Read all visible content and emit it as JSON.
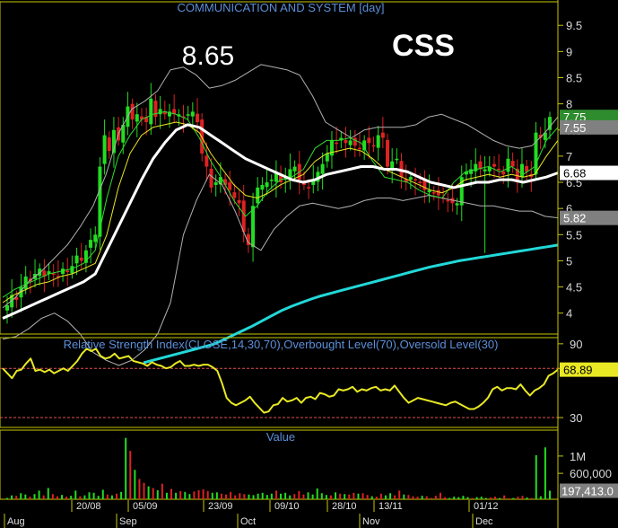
{
  "chart_data": [
    {
      "type": "candlestick",
      "title": "COMMUNICATION AND SYSTEM [day]",
      "symbol": "CSS",
      "peak_annotation": "8.65",
      "ylim": [
        3.6,
        9.95
      ],
      "yticks": [
        "9.5",
        "9",
        "8.5",
        "8",
        "7.5",
        "7",
        "6.5",
        "6",
        "5.5",
        "5",
        "4.5",
        "4"
      ],
      "price_badges": [
        {
          "label": "7.75",
          "value": 7.75,
          "bg": "#2e8b2e",
          "fg": "#ffffff"
        },
        {
          "label": "7.55",
          "value": 7.55,
          "bg": "#808080",
          "fg": "#ffffff"
        },
        {
          "label": "6.68",
          "value": 6.68,
          "bg": "#ffffff",
          "fg": "#000000"
        },
        {
          "label": "5.82",
          "value": 5.82,
          "bg": "#808080",
          "fg": "#ffffff"
        }
      ],
      "x_dates": [
        "20/08",
        "05/09",
        "23/09",
        "09/10",
        "28/10",
        "13/11",
        "01/12"
      ],
      "x_months": [
        "Aug",
        "Sep",
        "Oct",
        "Nov",
        "Dec"
      ],
      "series": [
        {
          "name": "close",
          "color": "#ffffff",
          "values": [
            4.15,
            4.35,
            4.25,
            4.5,
            4.7,
            4.6,
            4.75,
            4.85,
            4.7,
            4.8,
            4.75,
            4.7,
            4.85,
            4.8,
            4.9,
            5.1,
            5.0,
            5.2,
            5.4,
            5.5,
            6.8,
            7.4,
            7.1,
            7.5,
            7.3,
            7.6,
            7.95,
            7.7,
            7.8,
            7.7,
            7.65,
            8.1,
            7.75,
            7.9,
            7.8,
            7.85,
            7.8,
            7.8,
            7.75,
            7.8,
            7.85,
            7.65,
            7.05,
            6.8,
            6.4,
            6.5,
            6.6,
            6.45,
            6.35,
            6.2,
            6.1,
            5.55,
            5.3,
            6.05,
            6.4,
            6.45,
            6.5,
            6.55,
            6.7,
            6.5,
            6.6,
            6.75,
            6.8,
            6.55,
            6.45,
            6.4,
            6.55,
            6.7,
            6.85,
            7.05,
            7.3,
            7.25,
            7.35,
            7.25,
            7.3,
            7.2,
            7.15,
            7.3,
            7.25,
            7.2,
            7.4,
            7.35,
            6.8,
            6.9,
            6.95,
            6.6,
            6.5,
            6.6,
            6.55,
            6.5,
            6.35,
            6.35,
            6.3,
            6.25,
            6.2,
            6.15,
            6.1,
            6.1,
            6.6,
            6.7,
            6.75,
            6.85,
            6.75,
            6.75,
            6.8,
            6.8,
            6.75,
            6.65,
            6.95,
            6.8,
            6.55,
            6.85,
            6.7,
            6.6,
            7.45,
            7.35,
            7.45,
            7.75
          ]
        },
        {
          "name": "bb_upper",
          "color": "#b0b0b0",
          "values": [
            4.1,
            4.3,
            4.6,
            4.8,
            5.05,
            5.3,
            5.65,
            6.05,
            6.65,
            7.45,
            7.9,
            8.05,
            8.25,
            8.65,
            8.7,
            8.55,
            8.3,
            8.35,
            8.45,
            8.6,
            8.75,
            8.7,
            8.65,
            8.55,
            8.15,
            7.65,
            7.5,
            7.35,
            7.5,
            7.55,
            7.55,
            7.55,
            7.6,
            7.75,
            7.8,
            7.7,
            7.6,
            7.45,
            7.3,
            7.2,
            7.15,
            7.2,
            7.45,
            7.75
          ]
        },
        {
          "name": "bb_lower",
          "color": "#b0b0b0",
          "values": [
            3.5,
            3.55,
            3.7,
            3.9,
            4.0,
            3.85,
            3.6,
            3.25,
            3.1,
            3.0,
            3.1,
            3.3,
            3.6,
            4.2,
            5.5,
            6.15,
            6.65,
            6.45,
            5.95,
            5.35,
            5.2,
            5.6,
            5.85,
            6.05,
            6.1,
            6.05,
            6.0,
            6.05,
            6.15,
            6.2,
            6.2,
            6.15,
            6.2,
            6.25,
            6.2,
            6.15,
            6.1,
            6.05,
            6.05,
            6.0,
            5.95,
            5.95,
            5.85,
            5.82
          ]
        },
        {
          "name": "ma_fast",
          "color": "#2fdc2f",
          "values": [
            4.3,
            4.45,
            4.55,
            4.65,
            4.75,
            4.8,
            4.85,
            4.95,
            5.2,
            6.2,
            7.0,
            7.4,
            7.7,
            7.8,
            7.85,
            7.8,
            7.7,
            7.35,
            6.9,
            6.55,
            6.15,
            5.85,
            6.05,
            6.35,
            6.55,
            6.6,
            6.75,
            7.15,
            7.3,
            7.3,
            7.35,
            7.25,
            6.9,
            6.6,
            6.55,
            6.5,
            6.35,
            6.25,
            6.2,
            6.5,
            6.7,
            6.75,
            6.8,
            6.7,
            6.8,
            6.65,
            6.8,
            7.3,
            7.55
          ]
        },
        {
          "name": "ma_mid",
          "color": "#e8e824",
          "values": [
            4.2,
            4.35,
            4.45,
            4.55,
            4.6,
            4.7,
            4.75,
            4.85,
            4.95,
            5.5,
            6.4,
            7.05,
            7.4,
            7.55,
            7.6,
            7.65,
            7.6,
            7.45,
            7.05,
            6.75,
            6.45,
            6.25,
            6.2,
            6.3,
            6.45,
            6.55,
            6.65,
            6.9,
            7.05,
            7.1,
            7.15,
            7.1,
            6.95,
            6.75,
            6.65,
            6.55,
            6.45,
            6.35,
            6.3,
            6.4,
            6.55,
            6.6,
            6.65,
            6.6,
            6.65,
            6.6,
            6.65,
            7.0,
            7.3
          ]
        },
        {
          "name": "ma_slow",
          "color": "#ffffff",
          "values": [
            3.9,
            4.0,
            4.1,
            4.2,
            4.3,
            4.4,
            4.5,
            4.6,
            4.75,
            5.2,
            5.65,
            6.1,
            6.55,
            6.95,
            7.25,
            7.5,
            7.6,
            7.55,
            7.4,
            7.25,
            7.1,
            6.95,
            6.85,
            6.75,
            6.65,
            6.55,
            6.5,
            6.55,
            6.65,
            6.7,
            6.75,
            6.8,
            6.8,
            6.75,
            6.75,
            6.7,
            6.6,
            6.5,
            6.45,
            6.4,
            6.45,
            6.5,
            6.5,
            6.55,
            6.55,
            6.5,
            6.55,
            6.6,
            6.68
          ]
        },
        {
          "name": "ma_long",
          "color": "#22d8d8",
          "values": [
            3.05,
            3.1,
            3.15,
            3.2,
            3.25,
            3.3,
            3.35,
            3.4,
            3.48,
            3.57,
            3.66,
            3.75,
            3.85,
            3.95,
            4.05,
            4.13,
            4.2,
            4.27,
            4.33,
            4.38,
            4.43,
            4.48,
            4.53,
            4.58,
            4.63,
            4.68,
            4.73,
            4.78,
            4.83,
            4.88,
            4.92,
            4.96,
            5.0,
            5.03,
            5.06,
            5.09,
            5.12,
            5.15,
            5.18,
            5.21,
            5.24,
            5.27,
            5.3
          ]
        }
      ]
    },
    {
      "type": "line",
      "title": "Relative Strength Index(CLOSE,14,30,70),Overbought Level(70),Oversold Level(30)",
      "ylim": [
        22,
        95
      ],
      "yticks": [
        "90",
        "70",
        "30"
      ],
      "overbought": 70,
      "oversold": 30,
      "last_value_label": "68.89",
      "series": [
        {
          "name": "RSI",
          "color": "#e8e824",
          "values": [
            70,
            66,
            62,
            68,
            69,
            74,
            78,
            68,
            69,
            67,
            69,
            66,
            68,
            70,
            68,
            72,
            76,
            82,
            86,
            84,
            86,
            80,
            78,
            79,
            82,
            78,
            79,
            80,
            76,
            75,
            74,
            72,
            75,
            73,
            72,
            70,
            71,
            74,
            76,
            72,
            72,
            73,
            72,
            73,
            73,
            71,
            68,
            58,
            46,
            42,
            40,
            42,
            44,
            47,
            42,
            38,
            34,
            35,
            40,
            41,
            46,
            43,
            44,
            46,
            42,
            46,
            47,
            45,
            50,
            49,
            47,
            48,
            53,
            52,
            53,
            55,
            51,
            53,
            52,
            54,
            55,
            52,
            53,
            52,
            56,
            51,
            46,
            42,
            44,
            46,
            45,
            44,
            43,
            42,
            41,
            40,
            42,
            43,
            41,
            39,
            37,
            37,
            39,
            42,
            46,
            53,
            55,
            52,
            54,
            54,
            53,
            57,
            52,
            48,
            52,
            54,
            57,
            64,
            66,
            69
          ]
        }
      ]
    },
    {
      "type": "bar",
      "title": "Value",
      "yticks": [
        "1M",
        "600,000"
      ],
      "last_value_label": "197,413.0",
      "ylim": [
        0,
        1600000
      ],
      "series": [
        {
          "name": "volume",
          "values": [
            30000,
            90000,
            80000,
            140000,
            110000,
            60000,
            120000,
            200000,
            90000,
            260000,
            120000,
            70000,
            100000,
            60000,
            80000,
            200000,
            70000,
            90000,
            160000,
            150000,
            80000,
            220000,
            110000,
            90000,
            130000,
            170000,
            1420000,
            1120000,
            680000,
            470000,
            380000,
            300000,
            260000,
            210000,
            360000,
            150000,
            240000,
            150000,
            190000,
            170000,
            120000,
            180000,
            210000,
            230000,
            190000,
            150000,
            160000,
            130000,
            110000,
            170000,
            90000,
            140000,
            120000,
            110000,
            95000,
            130000,
            150000,
            100000,
            130000,
            200000,
            130000,
            150000,
            90000,
            120000,
            190000,
            110000,
            160000,
            110000,
            250000,
            140000,
            100000,
            90000,
            160000,
            130000,
            120000,
            110000,
            150000,
            130000,
            140000,
            100000,
            70000,
            60000,
            130000,
            90000,
            140000,
            90000,
            200000,
            110000,
            100000,
            70000,
            60000,
            80000,
            70000,
            30000,
            80000,
            150000,
            50000,
            30000,
            60000,
            50000,
            80000,
            50000,
            30000,
            50000,
            60000,
            30000,
            40000,
            60000,
            30000,
            90000,
            20000,
            30000,
            60000,
            80000,
            40000,
            30000,
            1020000,
            70000,
            1200000,
            197413
          ]
        }
      ]
    }
  ]
}
